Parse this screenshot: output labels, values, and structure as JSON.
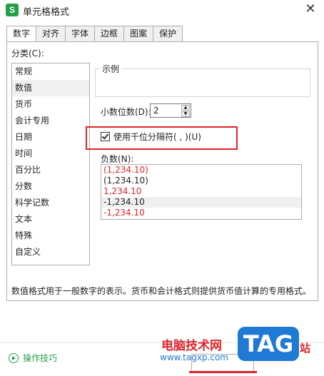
{
  "window": {
    "title": "单元格格式",
    "app_icon_letter": "S"
  },
  "tabs": [
    {
      "label": "数字",
      "active": true
    },
    {
      "label": "对齐"
    },
    {
      "label": "字体"
    },
    {
      "label": "边框"
    },
    {
      "label": "图案"
    },
    {
      "label": "保护"
    }
  ],
  "category": {
    "label": "分类(C):",
    "items": [
      "常规",
      "数值",
      "货币",
      "会计专用",
      "日期",
      "时间",
      "百分比",
      "分数",
      "科学记数",
      "文本",
      "特殊",
      "自定义"
    ],
    "selected": "数值"
  },
  "sample": {
    "legend": "示例"
  },
  "decimals": {
    "label": "小数位数(D):",
    "value": "2"
  },
  "separator": {
    "label": "使用千位分隔符( , )(U)",
    "checked": true
  },
  "negative": {
    "label": "负数(N):",
    "items": [
      "(1,234.10)",
      "(1,234.10)",
      "1,234.10",
      "-1,234.10",
      "-1,234.10"
    ]
  },
  "description": "数值格式用于一般数字的表示。货币和会计格式则提供货币值计算的专用格式。",
  "footer": {
    "tips_label": "操作技巧"
  },
  "watermark": {
    "text": "电脑技术网",
    "url": "www.tagxp.com",
    "badge": "TAG",
    "site": "站"
  },
  "colors": {
    "accent_green": "#25a047",
    "highlight_red": "#e0242a",
    "watermark_blue": "#1f7ad6"
  }
}
